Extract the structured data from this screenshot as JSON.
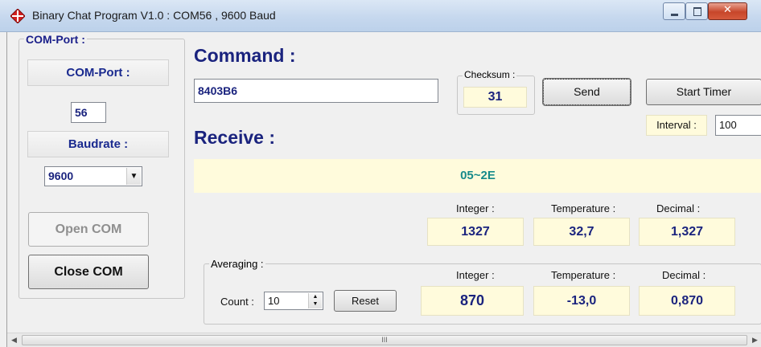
{
  "window": {
    "title": "Binary Chat Program V1.0 : COM56 , 9600 Baud"
  },
  "colors": {
    "accent": "#1a237e",
    "readout_bg": "#fffbdc",
    "receive_text": "#168a8a",
    "icon_red": "#d21f1f"
  },
  "com_port_group": {
    "title": "COM-Port :",
    "com_port_label": "COM-Port :",
    "com_port_value": "56",
    "baudrate_label": "Baudrate :",
    "baudrate_value": "9600",
    "open_label": "Open COM",
    "close_label": "Close COM"
  },
  "command": {
    "heading": "Command :",
    "value": "8403B6",
    "checksum_label": "Checksum :",
    "checksum_value": "31",
    "send_label": "Send",
    "start_timer_label": "Start Timer",
    "interval_label": "Interval :",
    "interval_value": "100"
  },
  "receive": {
    "heading": "Receive :",
    "value": "05~2E",
    "integer_label": "Integer :",
    "integer_value": "1327",
    "temperature_label": "Temperature :",
    "temperature_value": "32,7",
    "decimal_label": "Decimal :",
    "decimal_value": "1,327"
  },
  "averaging": {
    "title": "Averaging :",
    "count_label": "Count :",
    "count_value": "10",
    "reset_label": "Reset",
    "integer_label": "Integer :",
    "integer_value": "870",
    "temperature_label": "Temperature :",
    "temperature_value": "-13,0",
    "decimal_label": "Decimal :",
    "decimal_value": "0,870"
  },
  "scrollbar": {
    "thumb_grip": "III"
  }
}
